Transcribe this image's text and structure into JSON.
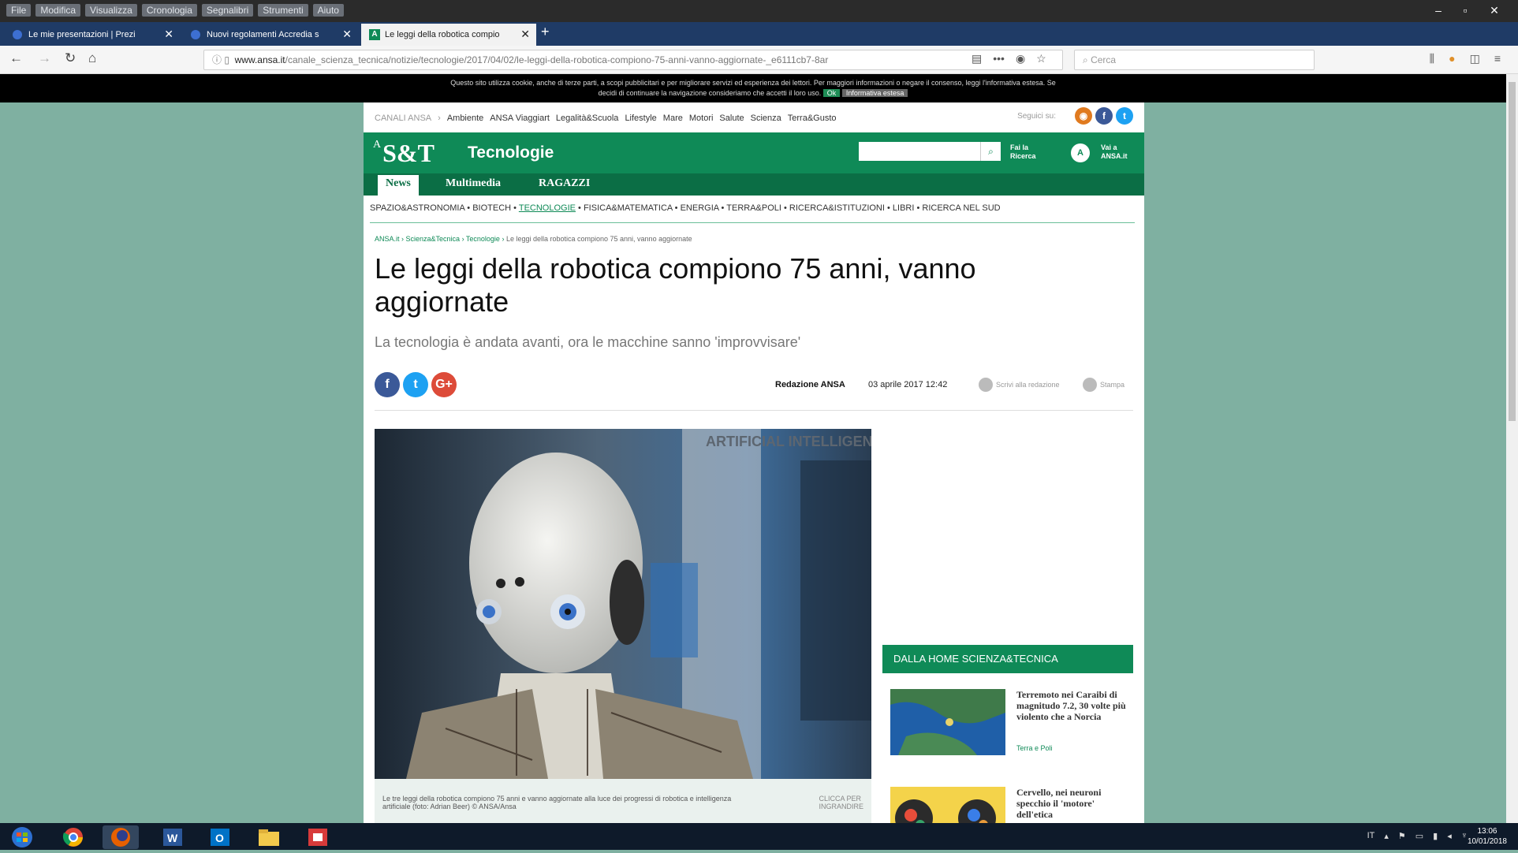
{
  "menubar": {
    "items": [
      "File",
      "Modifica",
      "Visualizza",
      "Cronologia",
      "Segnalibri",
      "Strumenti",
      "Aiuto"
    ]
  },
  "tabs": [
    {
      "label": "Le mie presentazioni | Prezi"
    },
    {
      "label": "Nuovi regolamenti Accredia s"
    },
    {
      "label": "Le leggi della robotica compio"
    }
  ],
  "url": {
    "domain": "www.ansa.it",
    "path": "/canale_scienza_tecnica/notizie/tecnologie/2017/04/02/le-leggi-della-robotica-compiono-75-anni-vanno-aggiornate-_e6111cb7-8ar"
  },
  "search_placeholder": "Cerca",
  "cookie": {
    "text1": "Questo sito utilizza cookie, anche di terze parti, a scopi pubblicitari e per migliorare servizi ed esperienza dei lettori. Per maggiori informazioni o negare il consenso, leggi l'informativa estesa. Se",
    "text2": "decidi di continuare la navigazione consideriamo che accetti il loro uso.",
    "ok": "Ok",
    "info": "Informativa estesa"
  },
  "topnav": {
    "canali": "CANALI ANSA",
    "items": [
      "Ambiente",
      "ANSA Viaggiart",
      "Legalità&Scuola",
      "Lifestyle",
      "Mare",
      "Motori",
      "Salute",
      "Scienza",
      "Terra&Gusto"
    ],
    "follow": "Seguici su:"
  },
  "header": {
    "logo_small": "A",
    "logo": "S&T",
    "section": "Tecnologie",
    "search_link": [
      "Fai la",
      "Ricerca"
    ],
    "ansa_link": [
      "Vai a",
      "ANSA.it"
    ],
    "ansa_badge": "A"
  },
  "subnav": [
    "News",
    "Multimedia",
    "RAGAZZI"
  ],
  "categories": [
    "SPAZIO&ASTRONOMIA",
    "BIOTECH",
    "TECNOLOGIE",
    "FISICA&MATEMATICA",
    "ENERGIA",
    "TERRA&POLI",
    "RICERCA&ISTITUZIONI",
    "LIBRI",
    "RICERCA NEL SUD"
  ],
  "breadcrumbs": [
    "ANSA.it",
    "Scienza&Tecnica",
    "Tecnologie",
    "Le leggi della robotica compiono 75 anni, vanno aggiornate"
  ],
  "article": {
    "title": "Le leggi della robotica compiono 75 anni, vanno aggiornate",
    "subtitle": "La tecnologia è andata avanti, ora le macchine sanno 'improvvisare'",
    "author": "Redazione ANSA",
    "date": "03 aprile 2017  12:42",
    "write": "Scrivi alla redazione",
    "print": "Stampa",
    "caption": "Le tre leggi della robotica compiono 75 anni e vanno aggiornate alla luce dei progressi di robotica e intelligenza artificiale (foto: Adrian Beer) © ANSA/Ansa",
    "zoom": [
      "CLICCA PER",
      "INGRANDIRE"
    ],
    "photo_sign": "ARTIFICIAL INTELLIGENCE LABORATORY"
  },
  "sidebar": {
    "heading": "DALLA HOME SCIENZA&TECNICA",
    "items": [
      {
        "title": "Terremoto nei Caraibi di magnitudo 7.2, 30 volte più violento che a Norcia",
        "category": "Terra e Poli"
      },
      {
        "title": "Cervello, nei neuroni specchio il 'motore' dell'etica",
        "category": ""
      }
    ]
  },
  "taskbar": {
    "lang": "IT",
    "time": "13:06",
    "date": "10/01/2018"
  },
  "colors": {
    "brand_green": "#0f8a57",
    "page_bg": "#7fb0a1"
  }
}
